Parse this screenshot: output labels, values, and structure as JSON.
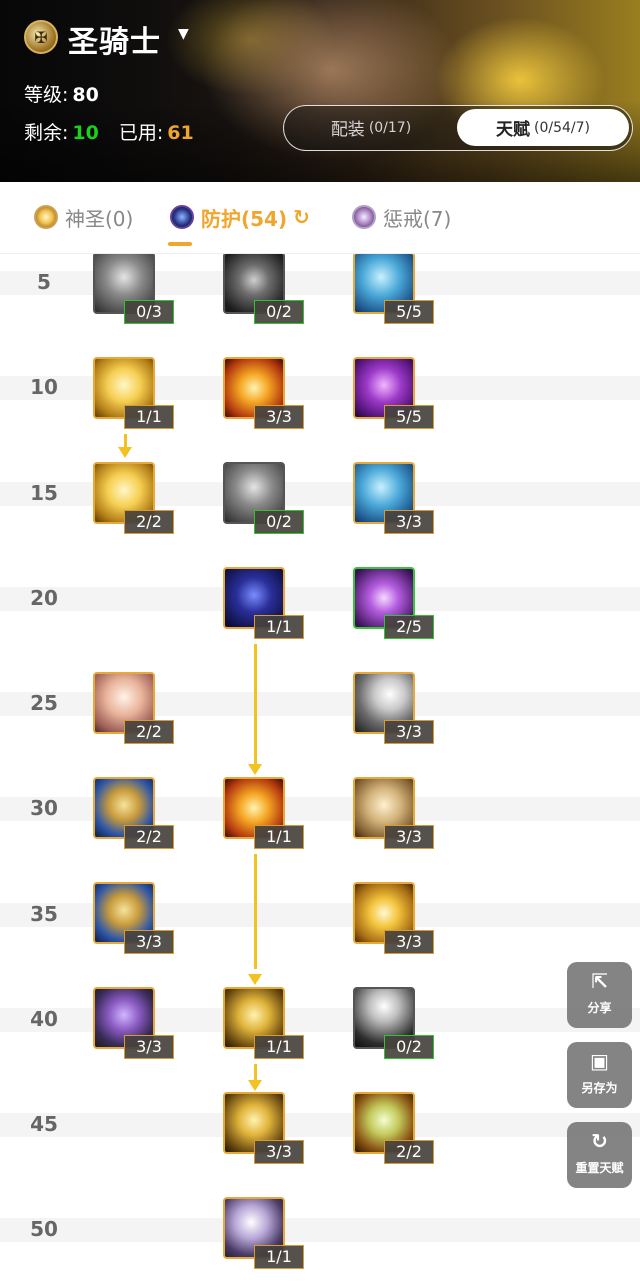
{
  "header": {
    "class_name": "圣骑士",
    "level_label": "等级:",
    "level_value": "80",
    "remaining_label": "剩余:",
    "remaining_value": "10",
    "used_label": "已用:",
    "used_value": "61",
    "colors": {
      "remaining": "#18d21c",
      "used": "#f0a52c"
    }
  },
  "segment": {
    "gear_label": "配装",
    "gear_count": "(0/17)",
    "talent_label": "天赋",
    "talent_count": "(0/54/7)"
  },
  "tabs": [
    {
      "label": "神圣(0)",
      "icon": "holy-tree-icon"
    },
    {
      "label": "防护(54)",
      "icon": "protection-tree-icon",
      "active": true
    },
    {
      "label": "惩戒(7)",
      "icon": "retribution-tree-icon"
    }
  ],
  "accent_color": "#f0a52c",
  "level_rows": [
    "5",
    "10",
    "15",
    "20",
    "25",
    "30",
    "35",
    "40",
    "45",
    "50"
  ],
  "talents": [
    {
      "rank": "0/3",
      "icon": "gray-fist-icon"
    },
    {
      "rank": "0/2",
      "icon": "crown-icon"
    },
    {
      "rank": "5/5",
      "icon": "blue-statue-icon"
    },
    {
      "rank": "1/1",
      "icon": "golden-tablet-icon"
    },
    {
      "rank": "3/3",
      "icon": "winged-sword-icon"
    },
    {
      "rank": "5/5",
      "icon": "purple-fist-icon"
    },
    {
      "rank": "2/2",
      "icon": "golden-tablet-icon"
    },
    {
      "rank": "0/2",
      "icon": "a-symbol-icon"
    },
    {
      "rank": "3/3",
      "icon": "blue-shield-icon"
    },
    {
      "rank": "1/1",
      "icon": "dark-shield-icon"
    },
    {
      "rank": "2/5",
      "icon": "crossed-swords-icon"
    },
    {
      "rank": "2/2",
      "icon": "light-cube-icon"
    },
    {
      "rank": "3/3",
      "icon": "sword-icon"
    },
    {
      "rank": "2/2",
      "icon": "golden-armor-icon"
    },
    {
      "rank": "1/1",
      "icon": "fire-shield-icon"
    },
    {
      "rank": "3/3",
      "icon": "knight-icon"
    },
    {
      "rank": "3/3",
      "icon": "shield-door-icon"
    },
    {
      "rank": "3/3",
      "icon": "golden-swords-icon"
    },
    {
      "rank": "3/3",
      "icon": "purple-mace-icon"
    },
    {
      "rank": "1/1",
      "icon": "golden-shield-icon"
    },
    {
      "rank": "0/2",
      "icon": "hooded-figure-icon"
    },
    {
      "rank": "3/3",
      "icon": "golden-helm-icon"
    },
    {
      "rank": "2/2",
      "icon": "gem-icon"
    },
    {
      "rank": "1/1",
      "icon": "hammer-icon"
    }
  ],
  "actions": {
    "share_label": "分享",
    "save_as_label": "另存为",
    "reset_label": "重置天赋"
  }
}
